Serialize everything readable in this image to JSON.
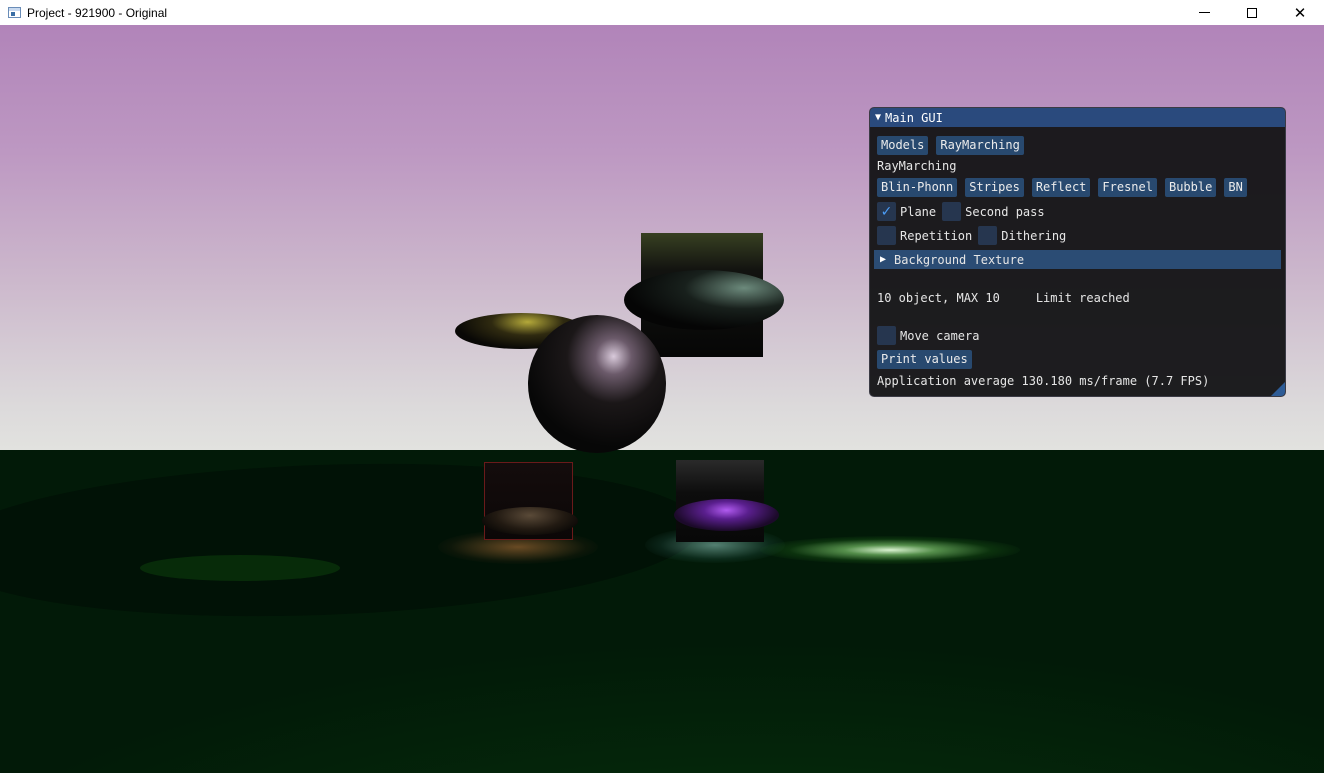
{
  "window": {
    "title": "Project - 921900 - Original",
    "minimize_glyph": "–",
    "close_glyph": "✕"
  },
  "gui": {
    "title": "Main GUI",
    "tabs": [
      "Models",
      "RayMarching"
    ],
    "section_label": "RayMarching",
    "shader_buttons": [
      "Blin-Phonn",
      "Stripes",
      "Reflect",
      "Fresnel",
      "Bubble",
      "BN"
    ],
    "checkboxes": {
      "plane": {
        "label": "Plane",
        "checked": true
      },
      "second_pass": {
        "label": "Second pass",
        "checked": false
      },
      "repetition": {
        "label": "Repetition",
        "checked": false
      },
      "dithering": {
        "label": "Dithering",
        "checked": false
      },
      "move_camera": {
        "label": "Move camera",
        "checked": false
      }
    },
    "background_texture_header": "Background Texture",
    "object_count": "10 object, MAX 10",
    "limit_status": "Limit reached",
    "print_values_button": "Print values",
    "perf_text": "Application average 130.180 ms/frame (7.7 FPS)",
    "check_glyph": "✓",
    "collapse_glyph": "▼",
    "expand_glyph": "▶"
  },
  "colors": {
    "accent": "#2a4a7d",
    "button": "#28496f",
    "checkmark": "#4b9cf5"
  }
}
